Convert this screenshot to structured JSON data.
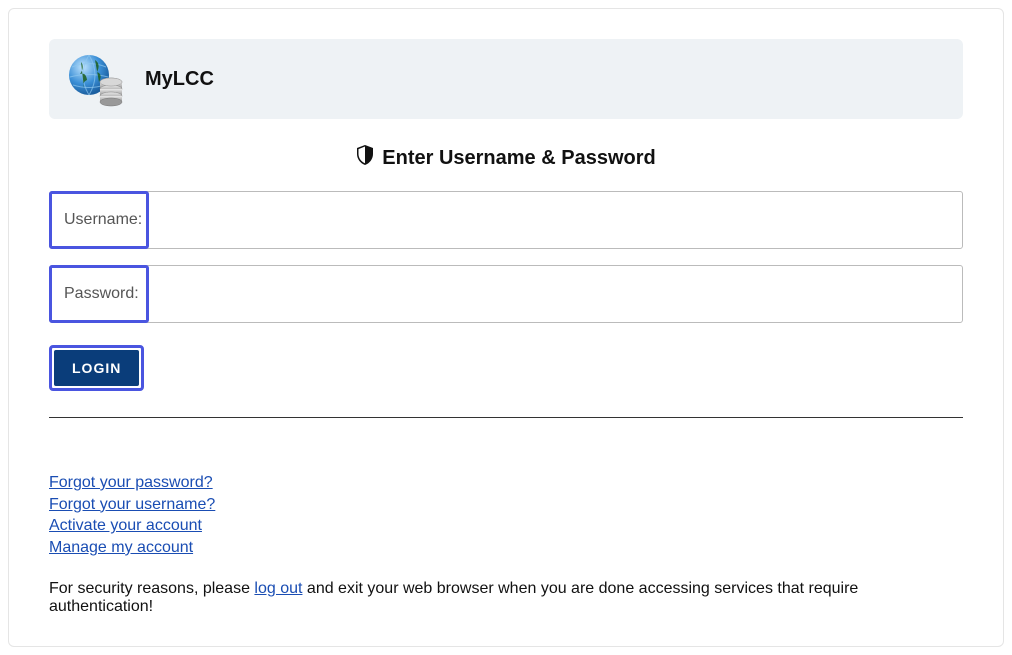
{
  "banner": {
    "title": "MyLCC"
  },
  "heading": "Enter Username & Password",
  "form": {
    "username_label": "Username:",
    "password_label": "Password:",
    "login_button": "LOGIN"
  },
  "links": {
    "forgot_password": "Forgot your password?",
    "forgot_username": "Forgot your username?",
    "activate_account": "Activate your account",
    "manage_account": "Manage my account"
  },
  "security": {
    "prefix": "For security reasons, please ",
    "logout_link": "log out",
    "suffix": " and exit your web browser when you are done accessing services that require authentication!"
  }
}
